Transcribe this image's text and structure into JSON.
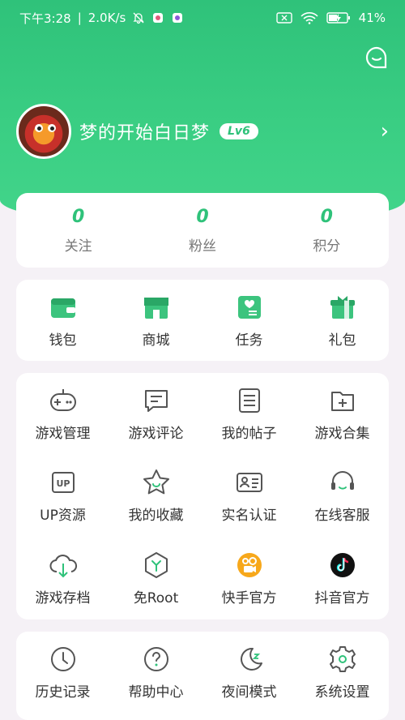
{
  "status_bar": {
    "time_text": "下午3:28",
    "speed": "2.0K/s",
    "battery": "41%"
  },
  "profile": {
    "username": "梦的开始白日梦",
    "level": "Lv6"
  },
  "stats": [
    {
      "value": "0",
      "label": "关注"
    },
    {
      "value": "0",
      "label": "粉丝"
    },
    {
      "value": "0",
      "label": "积分"
    }
  ],
  "wallet_row": [
    {
      "label": "钱包",
      "icon": "wallet-icon"
    },
    {
      "label": "商城",
      "icon": "store-icon"
    },
    {
      "label": "任务",
      "icon": "task-icon"
    },
    {
      "label": "礼包",
      "icon": "gift-icon"
    }
  ],
  "tools": [
    {
      "label": "游戏管理",
      "icon": "gamepad-icon"
    },
    {
      "label": "游戏评论",
      "icon": "comment-icon"
    },
    {
      "label": "我的帖子",
      "icon": "post-icon"
    },
    {
      "label": "游戏合集",
      "icon": "folder-plus-icon"
    },
    {
      "label": "UP资源",
      "icon": "up-icon"
    },
    {
      "label": "我的收藏",
      "icon": "star-icon"
    },
    {
      "label": "实名认证",
      "icon": "id-card-icon"
    },
    {
      "label": "在线客服",
      "icon": "headset-icon"
    },
    {
      "label": "游戏存档",
      "icon": "cloud-download-icon"
    },
    {
      "label": "免Root",
      "icon": "root-hex-icon"
    },
    {
      "label": "快手官方",
      "icon": "kuaishou-icon"
    },
    {
      "label": "抖音官方",
      "icon": "douyin-icon"
    }
  ],
  "misc": [
    {
      "label": "历史记录",
      "icon": "clock-icon"
    },
    {
      "label": "帮助中心",
      "icon": "help-icon"
    },
    {
      "label": "夜间模式",
      "icon": "moon-icon"
    },
    {
      "label": "系统设置",
      "icon": "settings-gear-icon"
    }
  ],
  "colors": {
    "brand_green": "#2fc27a",
    "page_bg": "#f5f1f6"
  }
}
